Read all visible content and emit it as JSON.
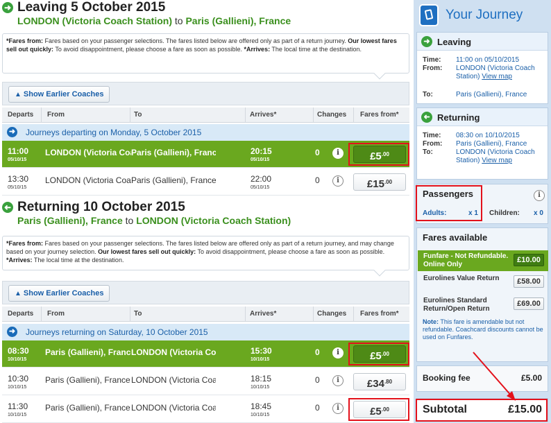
{
  "outbound": {
    "heading": "Leaving 5 October 2015",
    "route_from": "LONDON (Victoria Coach Station)",
    "route_to_word": "to",
    "route_to": "Paris (Gallieni), France",
    "notice_fares_label": "*Fares from:",
    "notice_fares_text": "Fares based on your passenger selections. The fares listed below are offered only as part of a return journey.",
    "notice_lowest_label": "Our lowest fares sell out quickly:",
    "notice_lowest_text": "To avoid disappointment, please choose a fare as soon as possible.",
    "notice_arrives_label": "*Arrives:",
    "notice_arrives_text": "The local time at the destination.",
    "earlier_label": "Show Earlier Coaches",
    "day_label": "Journeys departing on Monday, 5 October 2015",
    "rows": [
      {
        "time": "11:00",
        "date": "05/10/15",
        "from": "LONDON (Victoria Coach Station)",
        "to": "Paris (Gallieni), France",
        "arr_time": "20:15",
        "arr_date": "05/10/15",
        "changes": "0",
        "fare_main": "£5",
        "fare_dec": ".00",
        "selected": true
      },
      {
        "time": "13:30",
        "date": "05/10/15",
        "from": "LONDON (Victoria Coach Station)",
        "to": "Paris (Gallieni), France",
        "arr_time": "22:00",
        "arr_date": "05/10/15",
        "changes": "0",
        "fare_main": "£15",
        "fare_dec": ".00",
        "selected": false
      }
    ]
  },
  "inbound": {
    "heading": "Returning 10 October 2015",
    "route_from": "Paris (Gallieni), France",
    "route_to_word": "to",
    "route_to": "LONDON (Victoria Coach Station)",
    "notice_fares_label": "*Fares from:",
    "notice_fares_text": "Fares based on your passenger selections. The fares listed below are offered only as part of a return journey, and may change based on your journey selection.",
    "notice_lowest_label": "Our lowest fares sell out quickly:",
    "notice_lowest_text": "To avoid disappointment, please choose a fare as soon as possible.",
    "notice_arrives_label": "*Arrives:",
    "notice_arrives_text": "The local time at the destination.",
    "earlier_label": "Show Earlier Coaches",
    "day_label": "Journeys returning on Saturday, 10 October 2015",
    "rows": [
      {
        "time": "08:30",
        "date": "10/10/15",
        "from": "Paris (Gallieni), France",
        "to": "LONDON (Victoria Coach Station)",
        "arr_time": "15:30",
        "arr_date": "10/10/15",
        "changes": "0",
        "fare_main": "£5",
        "fare_dec": ".00",
        "selected": true
      },
      {
        "time": "10:30",
        "date": "10/10/15",
        "from": "Paris (Gallieni), France",
        "to": "LONDON (Victoria Coach Station)",
        "arr_time": "18:15",
        "arr_date": "10/10/15",
        "changes": "0",
        "fare_main": "£34",
        "fare_dec": ".80",
        "selected": false
      },
      {
        "time": "11:30",
        "date": "10/10/15",
        "from": "Paris (Gallieni), France",
        "to": "LONDON (Victoria Coach Station)",
        "arr_time": "18:45",
        "arr_date": "10/10/15",
        "changes": "0",
        "fare_main": "£5",
        "fare_dec": ".00",
        "selected": false
      }
    ]
  },
  "columns": {
    "departs": "Departs",
    "from": "From",
    "to": "To",
    "arrives": "Arrives*",
    "changes": "Changes",
    "fares": "Fares from*"
  },
  "journey": {
    "title": "Your Journey",
    "leaving": {
      "heading": "Leaving",
      "time_label": "Time:",
      "time": "11:00 on 05/10/2015",
      "from_label": "From:",
      "from": "LONDON (Victoria Coach Station)",
      "view_map": "View map",
      "to_label": "To:",
      "to": "Paris (Gallieni), France"
    },
    "returning": {
      "heading": "Returning",
      "time_label": "Time:",
      "time": "08:30 on 10/10/2015",
      "from_label": "From:",
      "from": "Paris (Gallieni), France",
      "to_label": "To:",
      "to": "LONDON (Victoria Coach Station)",
      "view_map": "View map"
    },
    "passengers": {
      "heading": "Passengers",
      "adults_label": "Adults:",
      "adults": "x 1",
      "children_label": "Children:",
      "children": "x 0"
    },
    "fares_available": {
      "heading": "Fares available",
      "items": [
        {
          "name": "Funfare - Not Refundable. Online Only",
          "price": "£10.00",
          "active": true
        },
        {
          "name": "Eurolines Value Return",
          "price": "£58.00",
          "active": false
        },
        {
          "name": "Eurolines Standard Return/Open Return",
          "price": "£69.00",
          "active": false
        }
      ],
      "note_label": "Note:",
      "note_text": "This fare is amendable but not refundable. Coachcard discounts cannot be used on Funfares."
    },
    "booking_fee_label": "Booking fee",
    "booking_fee": "£5.00",
    "subtotal_label": "Subtotal",
    "subtotal": "£15.00"
  },
  "colors": {
    "accent_green": "#6aa81f",
    "brand_blue": "#1e6fc1",
    "highlight_red": "#e3111b"
  }
}
